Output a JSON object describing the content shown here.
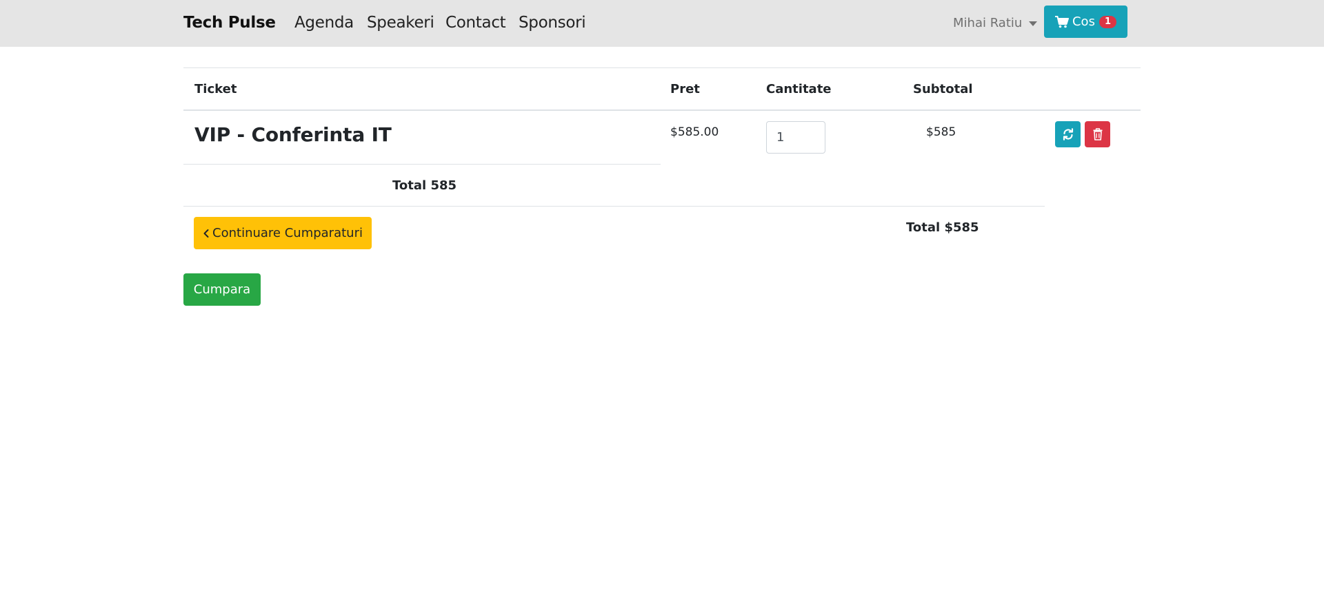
{
  "navbar": {
    "brand": "Tech Pulse",
    "links": [
      "Agenda",
      "Speakeri",
      "Contact",
      "Sponsori"
    ],
    "user_name": "Mihai Ratiu",
    "cart_label": "Cos",
    "cart_count": "1"
  },
  "cart_table": {
    "headers": {
      "ticket": "Ticket",
      "price": "Pret",
      "quantity": "Cantitate",
      "subtotal": "Subtotal"
    },
    "items": [
      {
        "name": "VIP - Conferinta IT",
        "price": "$585.00",
        "quantity": "1",
        "subtotal": "$585"
      }
    ],
    "total_inline": "Total 585",
    "total_footer": "Total $585"
  },
  "actions": {
    "continue_label": "Continuare Cumparaturi",
    "buy_label": "Cumpara"
  },
  "icons": {
    "cart": "shopping-cart-icon",
    "user_caret": "caret-down-icon",
    "refresh": "refresh-icon",
    "delete": "trash-icon",
    "continue": "chevron-left-icon"
  },
  "colors": {
    "navbar_bg": "#e5e5e5",
    "info": "#17a2b8",
    "danger": "#dc3545",
    "warning": "#ffc107",
    "success": "#28a745"
  }
}
